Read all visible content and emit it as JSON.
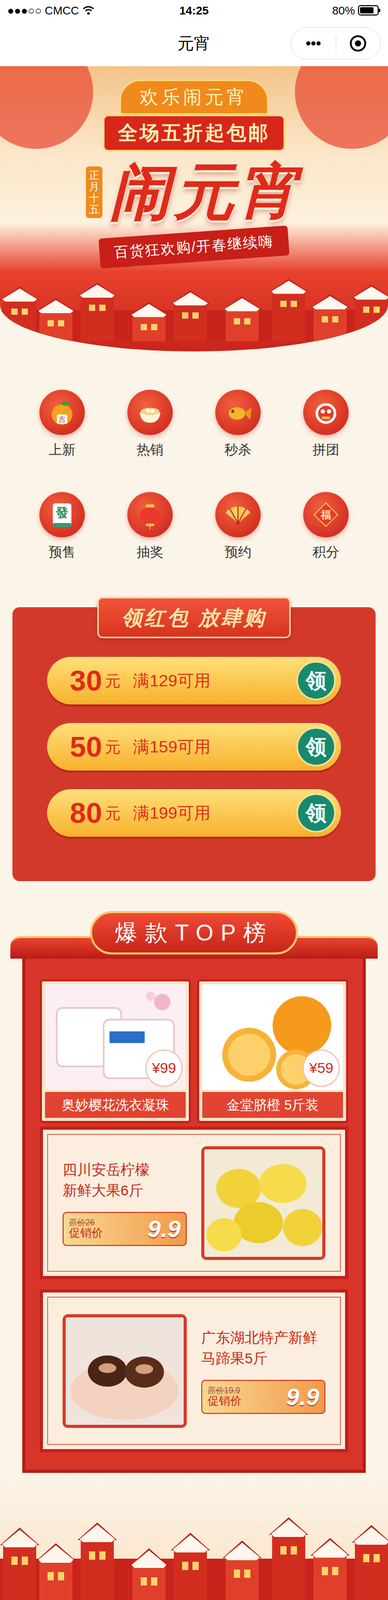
{
  "status_bar": {
    "carrier": "●●●○○ CMCC",
    "time": "14:25",
    "battery": "80%"
  },
  "nav": {
    "title": "元宵",
    "more": "•••"
  },
  "banner": {
    "tagline": "欢乐闹元宵",
    "promo": "全场五折起包邮",
    "date": "正月十五",
    "title": "闹元宵",
    "slogan": "百货狂欢购/开春继续嗨"
  },
  "categories": [
    {
      "label": "上新",
      "kind": "orange",
      "glyph": "吉"
    },
    {
      "label": "热销",
      "kind": "pudding"
    },
    {
      "label": "秒杀",
      "kind": "fish"
    },
    {
      "label": "拼团",
      "kind": "lion"
    },
    {
      "label": "预售",
      "kind": "mahjong",
      "glyph": "發"
    },
    {
      "label": "抽奖",
      "kind": "lantern"
    },
    {
      "label": "预约",
      "kind": "fan"
    },
    {
      "label": "积分",
      "kind": "fu",
      "glyph": "福"
    }
  ],
  "coupons": {
    "title": "领红包 放肆购",
    "items": [
      {
        "amount": "30",
        "unit": "元",
        "condition": "满129可用",
        "action": "领"
      },
      {
        "amount": "50",
        "unit": "元",
        "condition": "满159可用",
        "action": "领"
      },
      {
        "amount": "80",
        "unit": "元",
        "condition": "满199可用",
        "action": "领"
      }
    ]
  },
  "top": {
    "title": "爆款TOP榜",
    "featured": [
      {
        "name": "奥妙樱花洗衣凝珠",
        "price": "¥99"
      },
      {
        "name": "金堂脐橙 5斤装",
        "price": "¥59"
      }
    ],
    "deals": [
      {
        "name": "四川安岳柠檬新鲜大果6斤",
        "original": "原价26",
        "label": "促销价",
        "price": "9.9"
      },
      {
        "name": "广东湖北特产新鲜马蹄果5斤",
        "original": "原价19.9",
        "label": "促销价",
        "price": "9.9"
      }
    ]
  }
}
